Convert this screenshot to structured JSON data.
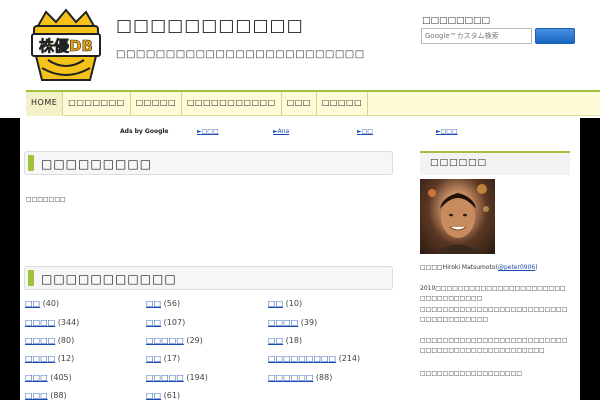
{
  "header": {
    "site_title": "□□□□□□□□□□□",
    "site_description": "□□□□□□□□□□□□□□□□□□□□□□□□□",
    "logo_text": "株優DB",
    "search": {
      "label": "□□□□□□□□",
      "placeholder": "Google™カスタム検索"
    }
  },
  "nav": {
    "items": [
      {
        "label": "HOME"
      },
      {
        "label": "□□□□□□□"
      },
      {
        "label": "□□□□□"
      },
      {
        "label": "□□□□□□□□□□□"
      },
      {
        "label": "□□□"
      },
      {
        "label": "□□□□□"
      }
    ]
  },
  "ads": {
    "label": "Ads by Google",
    "links": [
      "►□□□",
      "►Ana",
      "►□□",
      "►□□□"
    ]
  },
  "news_section": {
    "title": "□□□□□□□□□",
    "empty_text": "□□□□□□□"
  },
  "category_section": {
    "title": "□□□□□□□□□□□",
    "items": [
      {
        "name": "□□",
        "count": "(40)"
      },
      {
        "name": "□□",
        "count": "(56)"
      },
      {
        "name": "□□",
        "count": "(10)"
      },
      {
        "name": "□□□□",
        "count": "(344)"
      },
      {
        "name": "□□",
        "count": "(107)"
      },
      {
        "name": "□□□□",
        "count": "(39)"
      },
      {
        "name": "□□□□",
        "count": "(80)"
      },
      {
        "name": "□□□□□",
        "count": "(29)"
      },
      {
        "name": "□□",
        "count": "(18)"
      },
      {
        "name": "□□□□",
        "count": "(12)"
      },
      {
        "name": "□□",
        "count": "(17)"
      },
      {
        "name": "□□□□□□□□□",
        "count": "(214)"
      },
      {
        "name": "□□□",
        "count": "(405)"
      },
      {
        "name": "□□□□□",
        "count": "(194)"
      },
      {
        "name": "□□□□□□",
        "count": "(88)"
      },
      {
        "name": "□□□",
        "count": "(88)"
      },
      {
        "name": "□□",
        "count": "(61)"
      }
    ]
  },
  "sidebar": {
    "profile_title": "□□□□□□",
    "profile_name_prefix": "□□□□Hiroki Matsumoto(",
    "profile_handle": "@peter0906",
    "profile_name_suffix": ")",
    "paragraphs": [
      "2010□□□□□□□□□□□□□□□□□□□□□□□□□□□□□□□□□□",
      "□□□□□□□□□□□□□□□□□□□□□□□□□□□□□□□□□□□□□□",
      "□□□□□□□□□□□□□□□□□□□□□□□□□□□□□□□□□□□□□□□□□□□□□□□□",
      "□□□□□□□□□□□□□□□□□□"
    ]
  },
  "colors": {
    "accent_green": "#9ec23a",
    "nav_bg": "#fdfbd8",
    "link_blue": "#1a4cb3"
  }
}
